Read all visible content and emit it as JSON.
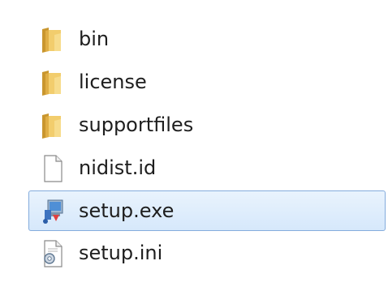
{
  "files": [
    {
      "name": "bin",
      "icon": "folder-icon",
      "selected": false
    },
    {
      "name": "license",
      "icon": "folder-icon",
      "selected": false
    },
    {
      "name": "supportfiles",
      "icon": "folder-icon",
      "selected": false
    },
    {
      "name": "nidist.id",
      "icon": "blank-file-icon",
      "selected": false
    },
    {
      "name": "setup.exe",
      "icon": "installer-icon",
      "selected": true
    },
    {
      "name": "setup.ini",
      "icon": "config-file-icon",
      "selected": false
    }
  ],
  "colors": {
    "selection_fill": "#d6e8fb",
    "selection_border": "#84acdd",
    "folder": "#e8b84a",
    "text": "#1e1e1e"
  }
}
